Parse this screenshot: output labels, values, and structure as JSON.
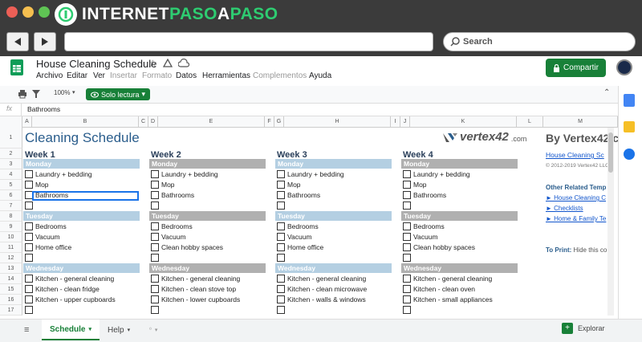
{
  "watermark": {
    "part1": "INTERNET",
    "part2": "PASO",
    "part3": "A",
    "part4": "PASO"
  },
  "browser": {
    "search_placeholder": "Search"
  },
  "doc": {
    "title": "House Cleaning Schedule"
  },
  "menu": [
    {
      "label": "Archivo",
      "disabled": false
    },
    {
      "label": "Editar",
      "disabled": false
    },
    {
      "label": "Ver",
      "disabled": false
    },
    {
      "label": "Insertar",
      "disabled": true
    },
    {
      "label": "Formato",
      "disabled": true
    },
    {
      "label": "Datos",
      "disabled": false
    },
    {
      "label": "Herramientas",
      "disabled": false
    },
    {
      "label": "Complementos",
      "disabled": true
    },
    {
      "label": "Ayuda",
      "disabled": false
    }
  ],
  "share_label": "Compartir",
  "toolbar": {
    "zoom": "100%",
    "readonly": "Solo lectura"
  },
  "formula": {
    "fx": "fx",
    "value": "Bathrooms"
  },
  "columns": [
    "A",
    "B",
    "C",
    "D",
    "E",
    "F",
    "G",
    "H",
    "I",
    "J",
    "K",
    "L",
    "M"
  ],
  "rows": [
    "1",
    "2",
    "3",
    "4",
    "5",
    "6",
    "7",
    "8",
    "9",
    "10",
    "11",
    "12",
    "13",
    "14",
    "15",
    "16",
    "17"
  ],
  "sheet": {
    "title": "Cleaning Schedule",
    "brand": "vertex42",
    "brand_suffix": ".com",
    "by": "By Vertex42.c",
    "link1": "House Cleaning Sc",
    "copyright": "© 2012-2019 Vertex42 LLC",
    "other_related": "Other Related Temp",
    "related": [
      "► House Cleaning C",
      "► Checklists",
      "► Home & Family Te"
    ],
    "to_print": "To Print:",
    "to_print_text": "Hide this co"
  },
  "weeks": [
    {
      "label": "Week 1",
      "days": [
        {
          "name": "Monday",
          "tasks": [
            "Laundry + bedding",
            "Mop",
            "Bathrooms",
            ""
          ]
        },
        {
          "name": "Tuesday",
          "tasks": [
            "Bedrooms",
            "Vacuum",
            "Home office",
            ""
          ]
        },
        {
          "name": "Wednesday",
          "tasks": [
            "Kitchen - general cleaning",
            "Kitchen - clean fridge",
            "Kitchen - upper cupboards",
            ""
          ]
        }
      ]
    },
    {
      "label": "Week 2",
      "days": [
        {
          "name": "Monday",
          "tasks": [
            "Laundry + bedding",
            "Mop",
            "Bathrooms",
            ""
          ]
        },
        {
          "name": "Tuesday",
          "tasks": [
            "Bedrooms",
            "Vacuum",
            "Clean hobby spaces",
            ""
          ]
        },
        {
          "name": "Wednesday",
          "tasks": [
            "Kitchen - general cleaning",
            "Kitchen - clean stove top",
            "Kitchen - lower cupboards",
            ""
          ]
        }
      ]
    },
    {
      "label": "Week 3",
      "days": [
        {
          "name": "Monday",
          "tasks": [
            "Laundry + bedding",
            "Mop",
            "Bathrooms",
            ""
          ]
        },
        {
          "name": "Tuesday",
          "tasks": [
            "Bedrooms",
            "Vacuum",
            "Home office",
            ""
          ]
        },
        {
          "name": "Wednesday",
          "tasks": [
            "Kitchen - general cleaning",
            "Kitchen - clean microwave",
            "Kitchen - walls & windows",
            ""
          ]
        }
      ]
    },
    {
      "label": "Week 4",
      "days": [
        {
          "name": "Monday",
          "tasks": [
            "Laundry + bedding",
            "Mop",
            "Bathrooms",
            ""
          ]
        },
        {
          "name": "Tuesday",
          "tasks": [
            "Bedrooms",
            "Vacuum",
            "Clean hobby spaces",
            ""
          ]
        },
        {
          "name": "Wednesday",
          "tasks": [
            "Kitchen - general cleaning",
            "Kitchen - clean oven",
            "Kitchen - small appliances",
            ""
          ]
        }
      ]
    }
  ],
  "tabs": {
    "schedule": "Schedule",
    "help": "Help"
  },
  "explore": "Explorar",
  "colors": {
    "day_blue": "#b4cfe2",
    "day_grey": "#b0b0b0",
    "share_green": "#188038",
    "title": "#2a5d8c"
  }
}
